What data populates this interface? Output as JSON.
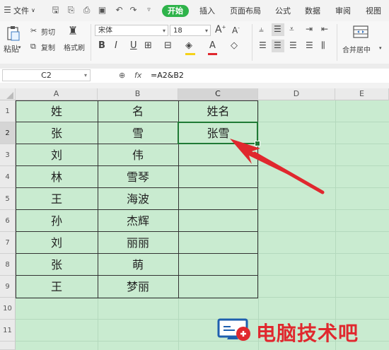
{
  "menubar": {
    "file_label": "文件",
    "tabs": [
      "开始",
      "插入",
      "页面布局",
      "公式",
      "数据",
      "审阅",
      "视图"
    ],
    "active_tab": "开始"
  },
  "toolbar": {
    "paste_label": "粘贴",
    "cut_label": "剪切",
    "copy_label": "复制",
    "format_painter_label": "格式刷",
    "font_name": "宋体",
    "font_size": "18",
    "bold": "B",
    "italic": "I",
    "underline": "U",
    "merge_label": "合并居中"
  },
  "formula_bar": {
    "name_box": "C2",
    "fx_label": "fx",
    "formula": "=A2&B2"
  },
  "sheet": {
    "columns": [
      "A",
      "B",
      "C",
      "D",
      "E"
    ],
    "selected_column": "C",
    "rows": [
      "1",
      "2",
      "3",
      "4",
      "5",
      "6",
      "7",
      "8",
      "9",
      "10",
      "11"
    ],
    "selected_row": "2",
    "cells": [
      [
        "姓",
        "名",
        "姓名"
      ],
      [
        "张",
        "雪",
        "张雪"
      ],
      [
        "刘",
        "伟",
        ""
      ],
      [
        "林",
        "雪琴",
        ""
      ],
      [
        "王",
        "海波",
        ""
      ],
      [
        "孙",
        "杰辉",
        ""
      ],
      [
        "刘",
        "丽丽",
        ""
      ],
      [
        "张",
        "萌",
        ""
      ],
      [
        "王",
        "梦丽",
        ""
      ]
    ]
  },
  "watermark": {
    "text": "电脑技术吧"
  },
  "colors": {
    "accent": "#2eb34a",
    "sheet_bg": "#c9ebd0",
    "arrow": "#e0282e"
  }
}
